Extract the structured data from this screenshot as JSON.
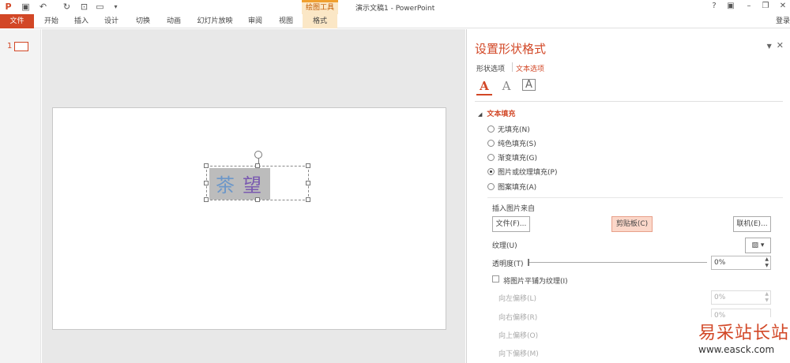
{
  "titlebar": {
    "app_title": "演示文稿1 - PowerPoint",
    "context_group": "绘图工具",
    "help": "?",
    "restore_ribbon": "▣",
    "minimize": "–",
    "maximize": "❐",
    "close": "✕"
  },
  "ribbon": {
    "tabs": [
      "文件",
      "开始",
      "插入",
      "设计",
      "切换",
      "动画",
      "幻灯片放映",
      "审阅",
      "视图",
      "格式"
    ],
    "login": "登录"
  },
  "thumbnails": {
    "slide_number": "1"
  },
  "slide": {
    "chars": [
      "茶",
      "望"
    ]
  },
  "pane": {
    "title": "设置形状格式",
    "tab_shape": "形状选项",
    "tab_text": "文本选项",
    "section": "文本填充",
    "options": [
      "无填充(N)",
      "纯色填充(S)",
      "渐变填充(G)",
      "图片或纹理填充(P)",
      "图案填充(A)"
    ],
    "insert_from": "插入图片来自",
    "btn_file": "文件(F)...",
    "btn_clipboard": "剪贴板(C)",
    "btn_online": "联机(E)...",
    "texture_label": "纹理(U)",
    "transparency_label": "透明度(T)",
    "transparency_value": "0%",
    "tile_label": "将图片平铺为纹理(I)",
    "offset_left_label": "向左偏移(L)",
    "offset_left_value": "0%",
    "offset_right_label": "向右偏移(R)",
    "offset_right_value": "0%",
    "offset_up_label": "向上偏移(O)",
    "offset_down_label": "向下偏移(M)"
  },
  "watermark": {
    "title": "易采站长站",
    "url": "www.easck.com"
  }
}
